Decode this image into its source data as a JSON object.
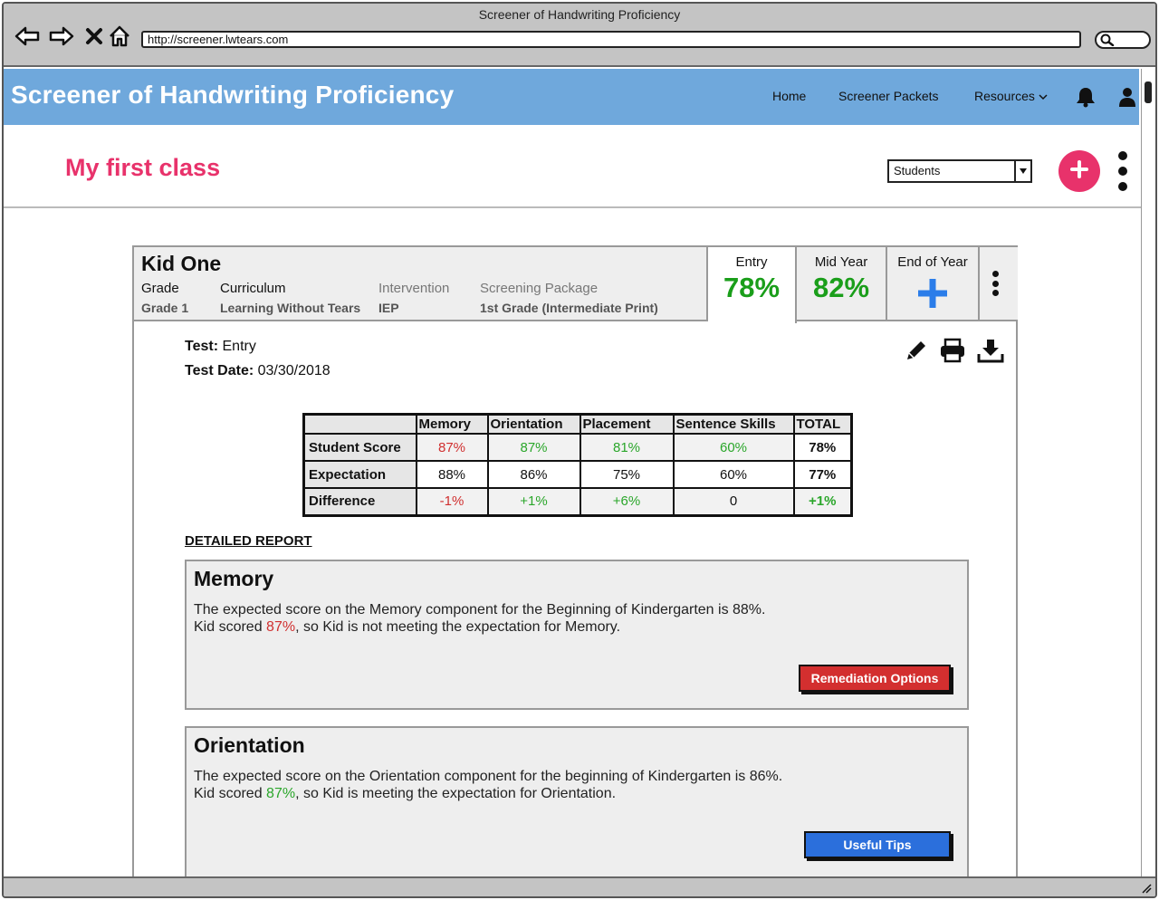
{
  "browser": {
    "window_title": "Screener of Handwriting Proficiency",
    "url": "http://screener.lwtears.com"
  },
  "app": {
    "title": "Screener of Handwriting Proficiency",
    "nav": [
      "Home",
      "Screener Packets",
      "Resources"
    ],
    "accent_color": "#6fa8dc"
  },
  "class": {
    "title": "My first class",
    "view_select": "Students",
    "accent_color": "#e8326b"
  },
  "student": {
    "name": "Kid One",
    "fields": [
      {
        "label": "Grade",
        "value": "Grade 1"
      },
      {
        "label": "Curriculum",
        "value": "Learning Without Tears"
      },
      {
        "label": "Intervention",
        "value": "IEP"
      },
      {
        "label": "Screening Package",
        "value": "1st Grade (Intermediate Print)"
      }
    ],
    "tabs": [
      {
        "label": "Entry",
        "value": "78%",
        "active": true
      },
      {
        "label": "Mid Year",
        "value": "82%",
        "active": false
      },
      {
        "label": "End of Year",
        "value": "",
        "active": false
      }
    ]
  },
  "test": {
    "test_label": "Test:",
    "test_value": "Entry",
    "date_label": "Test Date:",
    "date_value": "03/30/2018"
  },
  "scores": {
    "columns": [
      "",
      "Memory",
      "Orientation",
      "Placement",
      "Sentence Skills",
      "TOTAL"
    ],
    "rows": [
      {
        "label": "Student Score",
        "cells": [
          "87%",
          "87%",
          "81%",
          "60%",
          "78%"
        ]
      },
      {
        "label": "Expectation",
        "cells": [
          "88%",
          "86%",
          "75%",
          "60%",
          "77%"
        ]
      },
      {
        "label": "Difference",
        "cells": [
          "-1%",
          "+1%",
          "+6%",
          "0",
          "+1%"
        ]
      }
    ]
  },
  "report": {
    "heading": "DETAILED REPORT",
    "sections": [
      {
        "title": "Memory",
        "line1": "The expected score on the Memory component for the Beginning of Kindergarten is 88%.",
        "line2_prefix": "Kid scored ",
        "line2_score": "87%",
        "line2_suffix": ", so Kid is not meeting the expectation for Memory.",
        "button": "Remediation Options",
        "button_color": "#d32f2f"
      },
      {
        "title": "Orientation",
        "line1": "The expected score on the Orientation component for the beginning of Kindergarten is 86%.",
        "line2_prefix": "Kid scored ",
        "line2_score": "87%",
        "line2_suffix": ", so Kid is meeting the expectation for Orientation.",
        "button": "Useful Tips",
        "button_color": "#2b6fdc"
      }
    ]
  },
  "icons": [
    "back-arrow-icon",
    "forward-arrow-icon",
    "close-icon",
    "home-icon",
    "search-icon",
    "chevron-down-icon",
    "bell-icon",
    "user-icon",
    "plus-icon",
    "kebab-menu-icon",
    "pencil-icon",
    "printer-icon",
    "download-icon"
  ]
}
